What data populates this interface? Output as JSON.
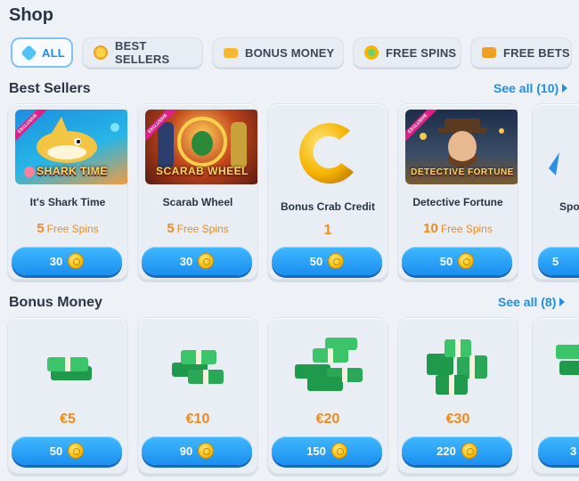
{
  "page": {
    "title": "Shop"
  },
  "tabs": [
    {
      "label": "ALL",
      "icon": "star-icon",
      "active": true
    },
    {
      "label": "BEST SELLERS",
      "icon": "medal-icon"
    },
    {
      "label": "BONUS MONEY",
      "icon": "cash-icon"
    },
    {
      "label": "FREE SPINS",
      "icon": "spin-coin-icon"
    },
    {
      "label": "FREE BETS",
      "icon": "ticket-icon"
    }
  ],
  "best_sellers": {
    "title": "Best Sellers",
    "see_all": "See all (10)",
    "items": [
      {
        "name": "It's Shark Time",
        "count": "5",
        "unit": "Free Spins",
        "price": "30",
        "art_text": "SHARK TIME",
        "exclusive": "EXCLUSIVE"
      },
      {
        "name": "Scarab Wheel",
        "count": "5",
        "unit": "Free Spins",
        "price": "30",
        "art_text": "SCARAB WHEEL",
        "exclusive": "EXCLUSIVE"
      },
      {
        "name": "Bonus Crab Credit",
        "count": "1",
        "unit": "",
        "price": "50"
      },
      {
        "name": "Detective Fortune",
        "count": "10",
        "unit": "Free Spins",
        "price": "50",
        "art_text": "DETECTIVE FORTUNE",
        "exclusive": "EXCLUSIVE"
      },
      {
        "name": "Spor",
        "count": "",
        "unit": "",
        "price": "5"
      }
    ]
  },
  "bonus_money": {
    "title": "Bonus Money",
    "see_all": "See all (8)",
    "items": [
      {
        "amount": "€5",
        "price": "50"
      },
      {
        "amount": "€10",
        "price": "90"
      },
      {
        "amount": "€20",
        "price": "150"
      },
      {
        "amount": "€30",
        "price": "220"
      },
      {
        "amount": "",
        "price": "3"
      }
    ]
  },
  "colors": {
    "accent": "#1e8fe5",
    "orange": "#f08a1c",
    "background": "#eef2f7"
  }
}
